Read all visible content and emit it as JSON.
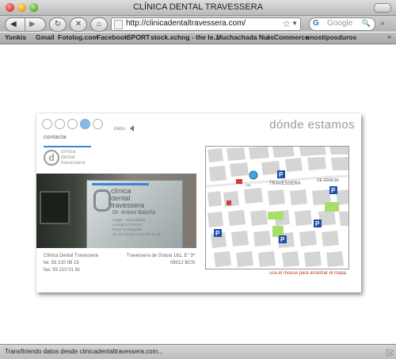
{
  "window": {
    "title": "CLÍNICA DENTAL TRAVESSERA"
  },
  "toolbar": {
    "url": "http://clinicadentaltravessera.com/",
    "search_placeholder": "Google",
    "search_engine_icon": "G"
  },
  "bookmarks": [
    "Yonkis",
    "Gmail",
    "Fotolog.com",
    "Facebook",
    "SPORT",
    "stock.xchng - the le...",
    "Muchachada Nui",
    "osCommerce",
    "unostiposduros"
  ],
  "page": {
    "nav_home_label": "inicio",
    "contact_label": "contacta",
    "heading": "dónde estamos",
    "logo_text": [
      "clínica",
      "dental",
      "travessera"
    ],
    "photo_sign": {
      "title": [
        "clínica",
        "dental",
        "travessera"
      ],
      "doctor": "Dr. Antoni Balañá",
      "small_lines": [
        "metge · estomatòleg",
        "col·legiat nº 01178",
        "hores convingudes",
        "tel. 93 210 08 15   93 210 01 81"
      ]
    },
    "address_left": [
      "Clínica Dental Travessera",
      "tel. 93 210 08 15",
      "fax: 93 210 01 81"
    ],
    "address_right": [
      "Travessera de Gràcia 181, E° 3ª",
      "08012 BCN"
    ],
    "map_hint": "usa el mouse para arrastrar el mapa",
    "map_labels": {
      "street_main": "TRAVESSERA",
      "street_gracia": "DE GRÀCIA",
      "number": "134"
    },
    "pager": {
      "total": 5,
      "active": 4
    }
  },
  "statusbar": {
    "text": "Transfiriendo datos desde clinicadentaltravessera.com..."
  }
}
